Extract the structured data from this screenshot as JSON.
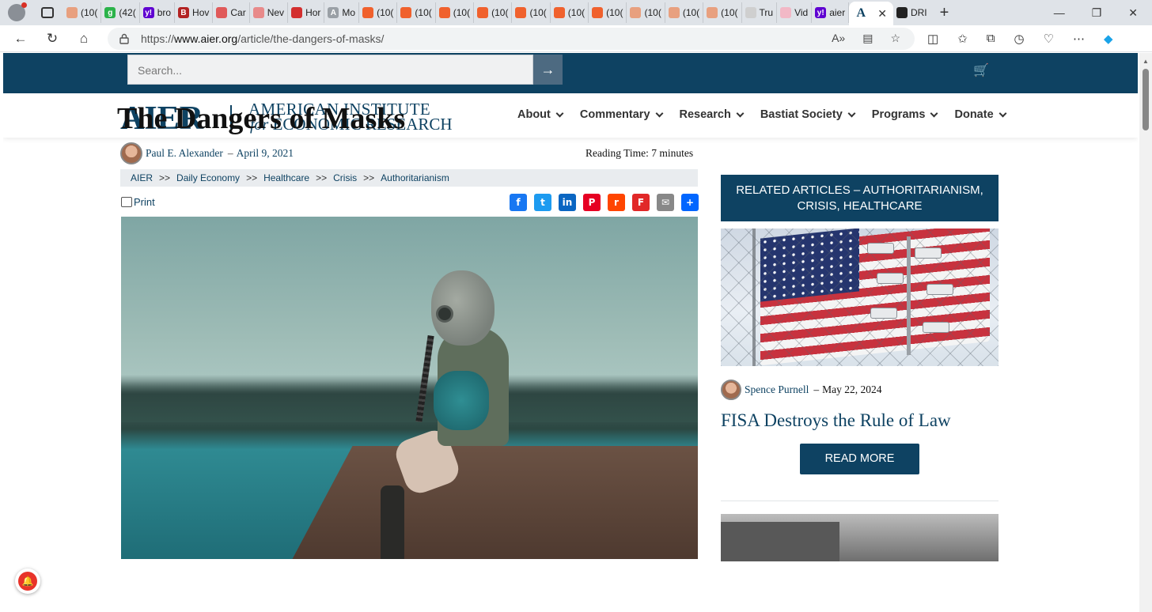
{
  "browser": {
    "tabs": [
      {
        "label": "(10(",
        "color": "#e8a07f",
        "glyph": ""
      },
      {
        "label": "(42(",
        "color": "#2bb34a",
        "glyph": "g"
      },
      {
        "label": "bro",
        "color": "#5f01d1",
        "glyph": "y!"
      },
      {
        "label": "Hov",
        "color": "#b22222",
        "glyph": "B"
      },
      {
        "label": "Car",
        "color": "#e05a5a",
        "glyph": ""
      },
      {
        "label": "Nev",
        "color": "#e88a8a",
        "glyph": ""
      },
      {
        "label": "Hor",
        "color": "#d32f2f",
        "glyph": ""
      },
      {
        "label": "Mo",
        "color": "#9aa0a6",
        "glyph": "A"
      },
      {
        "label": "(10(",
        "color": "#f0612d",
        "glyph": ""
      },
      {
        "label": "(10(",
        "color": "#f0612d",
        "glyph": ""
      },
      {
        "label": "(10(",
        "color": "#f0612d",
        "glyph": ""
      },
      {
        "label": "(10(",
        "color": "#f0612d",
        "glyph": ""
      },
      {
        "label": "(10(",
        "color": "#f0612d",
        "glyph": ""
      },
      {
        "label": "(10(",
        "color": "#f0612d",
        "glyph": ""
      },
      {
        "label": "(10(",
        "color": "#f0612d",
        "glyph": ""
      },
      {
        "label": "(10(",
        "color": "#e8a07f",
        "glyph": ""
      },
      {
        "label": "(10(",
        "color": "#e8a07f",
        "glyph": ""
      },
      {
        "label": "(10(",
        "color": "#e8a07f",
        "glyph": ""
      },
      {
        "label": "Tru",
        "color": "#cfcfcf",
        "glyph": ""
      },
      {
        "label": "Vid",
        "color": "#f2b8c6",
        "glyph": ""
      },
      {
        "label": "aier",
        "color": "#5f01d1",
        "glyph": "y!"
      }
    ],
    "active_tab": {
      "glyph": "A"
    },
    "after_tab": {
      "label": "DRI"
    },
    "url_prefix": "https://",
    "url_host": "www.aier.org",
    "url_path": "/article/the-dangers-of-masks/"
  },
  "site": {
    "search_placeholder": "Search...",
    "logo_main": "AIER",
    "logo_line1": "AMERICAN INSTITUTE",
    "logo_for": "for",
    "logo_line2": "ECONOMIC RESEARCH",
    "nav": [
      "About",
      "Commentary",
      "Research",
      "Bastiat Society",
      "Programs",
      "Donate"
    ]
  },
  "article": {
    "title": "The Dangers of Masks",
    "author": "Paul E. Alexander",
    "date_sep": "–",
    "date": "April 9, 2021",
    "reading_time": "Reading Time: 7 minutes",
    "breadcrumbs": [
      "AIER",
      "Daily Economy",
      "Healthcare",
      "Crisis",
      "Authoritarianism"
    ],
    "breadcrumb_sep": ">>",
    "print_label": "Print",
    "share": [
      {
        "name": "facebook",
        "color": "#1877f2",
        "glyph": "f"
      },
      {
        "name": "twitter",
        "color": "#1d9bf0",
        "glyph": "t"
      },
      {
        "name": "linkedin",
        "color": "#0a66c2",
        "glyph": "in"
      },
      {
        "name": "pinterest",
        "color": "#e60023",
        "glyph": "P"
      },
      {
        "name": "reddit",
        "color": "#ff4500",
        "glyph": "r"
      },
      {
        "name": "flipboard",
        "color": "#e12828",
        "glyph": "F"
      },
      {
        "name": "email",
        "color": "#888888",
        "glyph": "✉"
      },
      {
        "name": "share",
        "color": "#0166ff",
        "glyph": "+"
      }
    ]
  },
  "sidebar": {
    "heading": "RELATED ARTICLES – AUTHORITARIANISM, CRISIS, HEALTHCARE",
    "related_author": "Spence Purnell",
    "related_date_sep": "–",
    "related_date": "May 22, 2024",
    "related_title": "FISA Destroys the Rule of Law",
    "read_more": "READ MORE"
  },
  "colors": {
    "brand": "#0e4262",
    "breadcrumb_bg": "#e9ecef",
    "notification": "#e8332a"
  }
}
